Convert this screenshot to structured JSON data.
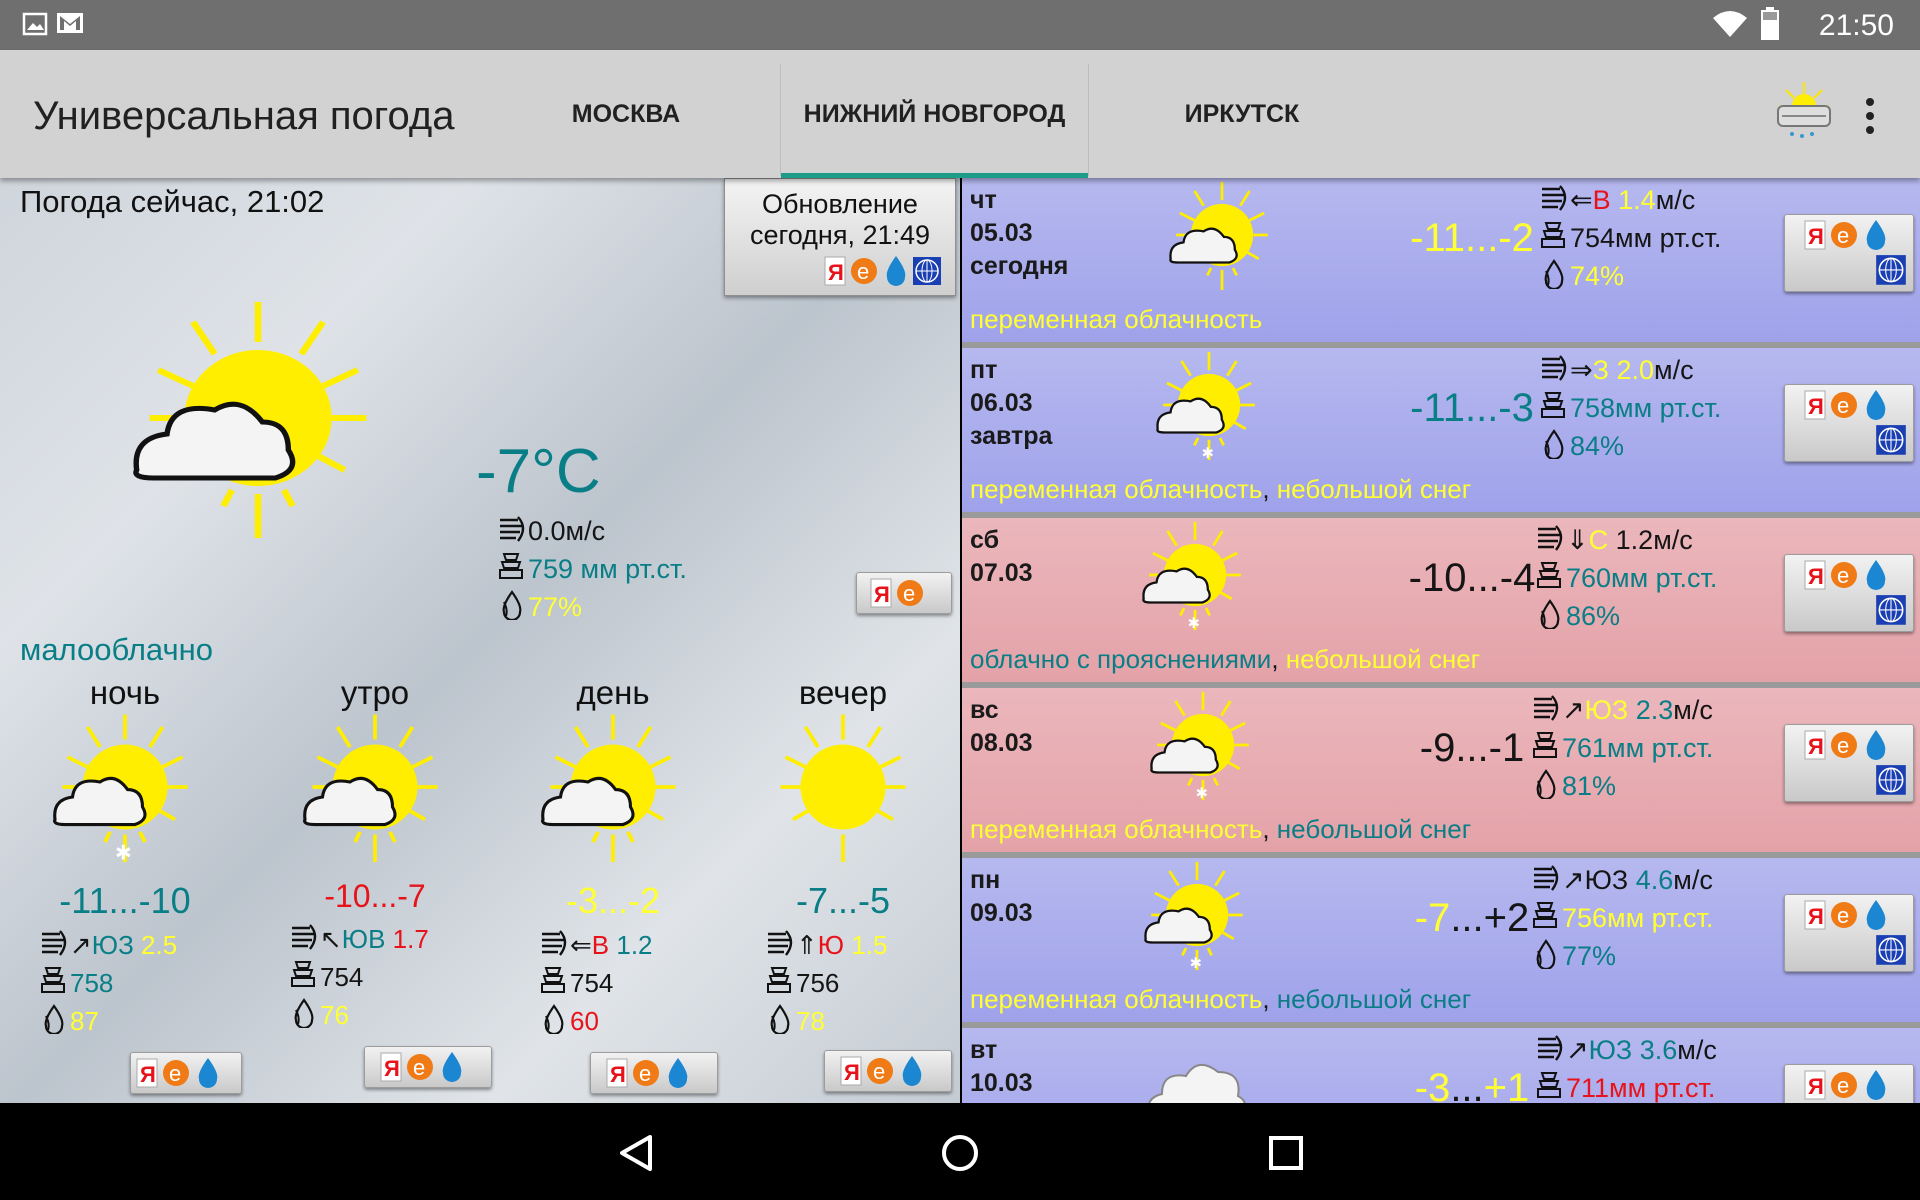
{
  "status": {
    "time": "21:50"
  },
  "app": {
    "title": "Универсальная погода"
  },
  "tabs": [
    {
      "label": "МОСКВА"
    },
    {
      "label": "НИЖНИЙ НОВГОРОД"
    },
    {
      "label": "ИРКУТСК"
    }
  ],
  "now": {
    "title": "Погода сейчас, 21:02",
    "update_line1": "Обновление",
    "update_line2": "сегодня, 21:49",
    "temp": "-7°C",
    "wind": "0.0м/с",
    "pressure": "759 мм рт.ст.",
    "humidity": "77%",
    "desc": "малооблачно"
  },
  "periods": [
    {
      "name": "ночь",
      "temp": "-11...-10",
      "wind_dir": "ЮЗ",
      "wind_speed": "2.5",
      "pressure": "758",
      "humidity": "87"
    },
    {
      "name": "утро",
      "temp": "-10...-7",
      "wind_dir": "ЮВ",
      "wind_speed": "1.7",
      "pressure": "754",
      "humidity": "76"
    },
    {
      "name": "день",
      "temp": "-3...-2",
      "wind_dir": "В",
      "wind_speed": "1.2",
      "pressure": "754",
      "humidity": "60"
    },
    {
      "name": "вечер",
      "temp": "-7...-5",
      "wind_dir": "Ю",
      "wind_speed": "1.5",
      "pressure": "756",
      "humidity": "78"
    }
  ],
  "days": [
    {
      "dow": "чт",
      "date": "05.03",
      "rel": "сегодня",
      "temp": "-11...-2",
      "wind_dir": "В",
      "wind_speed": "1.4",
      "unit": "м/с",
      "pressure": "754мм рт.ст.",
      "humidity": "74%",
      "desc1": "переменная облачность",
      "sep": "",
      "desc2": ""
    },
    {
      "dow": "пт",
      "date": "06.03",
      "rel": "завтра",
      "temp": "-11...-3",
      "wind_dir": "З",
      "wind_speed": "2.0",
      "unit": "м/с",
      "pressure": "758мм рт.ст.",
      "humidity": "84%",
      "desc1": "переменная облачность",
      "sep": ", ",
      "desc2": "небольшой снег"
    },
    {
      "dow": "сб",
      "date": "07.03",
      "rel": "",
      "temp": "-10...-4",
      "wind_dir": "С",
      "wind_speed": "1.2",
      "unit": "м/с",
      "pressure": "760мм рт.ст.",
      "humidity": "86%",
      "desc1": "облачно с прояснениями",
      "sep": ", ",
      "desc2": "небольшой снег"
    },
    {
      "dow": "вс",
      "date": "08.03",
      "rel": "",
      "temp": "-9...-1",
      "wind_dir": "ЮЗ",
      "wind_speed": "2.3",
      "unit": "м/с",
      "pressure": "761мм рт.ст.",
      "humidity": "81%",
      "desc1": "переменная облачность",
      "sep": ", ",
      "desc2": "небольшой снег"
    },
    {
      "dow": "пн",
      "date": "09.03",
      "rel": "",
      "temp": "-7...+2",
      "wind_dir": "ЮЗ",
      "wind_speed": "4.6",
      "unit": "м/с",
      "pressure": "756мм рт.ст.",
      "humidity": "77%",
      "desc1": "переменная облачность",
      "sep": ", ",
      "desc2": "небольшой снег"
    },
    {
      "dow": "вт",
      "date": "10.03",
      "rel": "",
      "temp": "-3...+1",
      "wind_dir": "ЮЗ",
      "wind_speed": "3.6",
      "unit": "м/с",
      "pressure": "711мм рт.ст.",
      "humidity": "",
      "desc1": "",
      "sep": "",
      "desc2": ""
    }
  ],
  "icons": [
    "image-icon",
    "mail-icon",
    "wifi-icon",
    "battery-icon",
    "weather-widget-icon",
    "more-vert-icon",
    "sun-cloud-icon",
    "wind-icon",
    "pressure-icon",
    "humidity-icon",
    "yandex-source-icon",
    "gismeteo-source-icon",
    "drop-source-icon",
    "globe-source-icon",
    "back-icon",
    "home-icon",
    "recents-icon"
  ],
  "colors": {
    "accent": "#1e9c8a",
    "blue_row": "#a3a6eb",
    "red_row": "#e6aab0",
    "yellow": "#ffff33",
    "teal": "#0a7e86",
    "red": "#e8131a"
  }
}
